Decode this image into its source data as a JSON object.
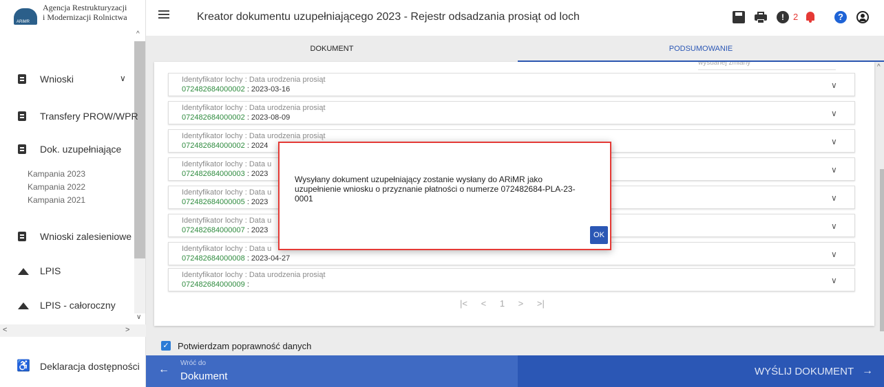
{
  "logo": {
    "line1": "Agencja Restrukturyzacji",
    "line2": "i Modernizacji Rolnictwa",
    "mark_text": "ARiMR"
  },
  "sidebar": {
    "items": [
      {
        "label": "Wnioski",
        "chevron": "∨",
        "icon": "document-icon"
      },
      {
        "label": "Transfery PROW/WPR",
        "chevron": "",
        "icon": "document-icon"
      },
      {
        "label": "Dok. uzupełniające",
        "chevron": "^",
        "icon": "document-icon"
      },
      {
        "label": "Wnioski zalesieniowe",
        "chevron": "∨",
        "icon": "document-icon"
      },
      {
        "label": "LPIS",
        "chevron": "",
        "icon": "mountain-icon"
      },
      {
        "label": "LPIS - całoroczny",
        "chevron": "",
        "icon": "mountain-icon"
      }
    ],
    "sub_items": [
      "Kampania 2023",
      "Kampania 2022",
      "Kampania 2021"
    ],
    "accessibility_label": "Deklaracja dostępności"
  },
  "header": {
    "title": "Kreator dokumentu uzupełniającego 2023 - Rejestr odsadzania prosiąt od loch",
    "alert_count": "2",
    "alert_symbol": "!",
    "help_symbol": "?"
  },
  "tabs": [
    {
      "label": "DOKUMENT",
      "active": false
    },
    {
      "label": "PODSUMOWANIE",
      "active": true
    }
  ],
  "card": {
    "cut_text": "wysuanej zmiany",
    "rows": [
      {
        "label": "Identyfikator lochy : Data urodzenia prosiąt",
        "id": "072482684000002",
        "date": " : 2023-03-16"
      },
      {
        "label": "Identyfikator lochy : Data urodzenia prosiąt",
        "id": "072482684000002",
        "date": " : 2023-08-09"
      },
      {
        "label": "Identyfikator lochy : Data urodzenia prosiąt",
        "id": "072482684000002",
        "date": " : 2024"
      },
      {
        "label": "Identyfikator lochy : Data u",
        "id": "072482684000003",
        "date": " : 2023"
      },
      {
        "label": "Identyfikator lochy : Data u",
        "id": "072482684000005",
        "date": " : 2023"
      },
      {
        "label": "Identyfikator lochy : Data u",
        "id": "072482684000007",
        "date": " : 2023"
      },
      {
        "label": "Identyfikator lochy : Data u",
        "id": "072482684000008",
        "date": " : 2023-04-27"
      },
      {
        "label": "Identyfikator lochy : Data urodzenia prosiąt",
        "id": "072482684000009",
        "date": " :"
      }
    ],
    "pager": {
      "first": "|<",
      "prev": "<",
      "page": "1",
      "next": ">",
      "last": ">|"
    }
  },
  "confirm": {
    "label": "Potwierdzam poprawność danych",
    "checked": true
  },
  "footer": {
    "back_small": "Wróć do",
    "back_big": "Dokument",
    "send_label": "WYŚLIJ DOKUMENT"
  },
  "modal": {
    "text": "Wysyłany dokument uzupełniający zostanie wysłany do ARiMR jako uzupełnienie wniosku o przyznanie płatności o numerze 072482684-PLA-23-0001",
    "ok_label": "OK"
  },
  "colors": {
    "accent": "#2b57b5",
    "highlight_border": "#e53935",
    "id_green": "#2e8b3e",
    "alert_red": "#e53935",
    "help_blue": "#1e63d6"
  }
}
